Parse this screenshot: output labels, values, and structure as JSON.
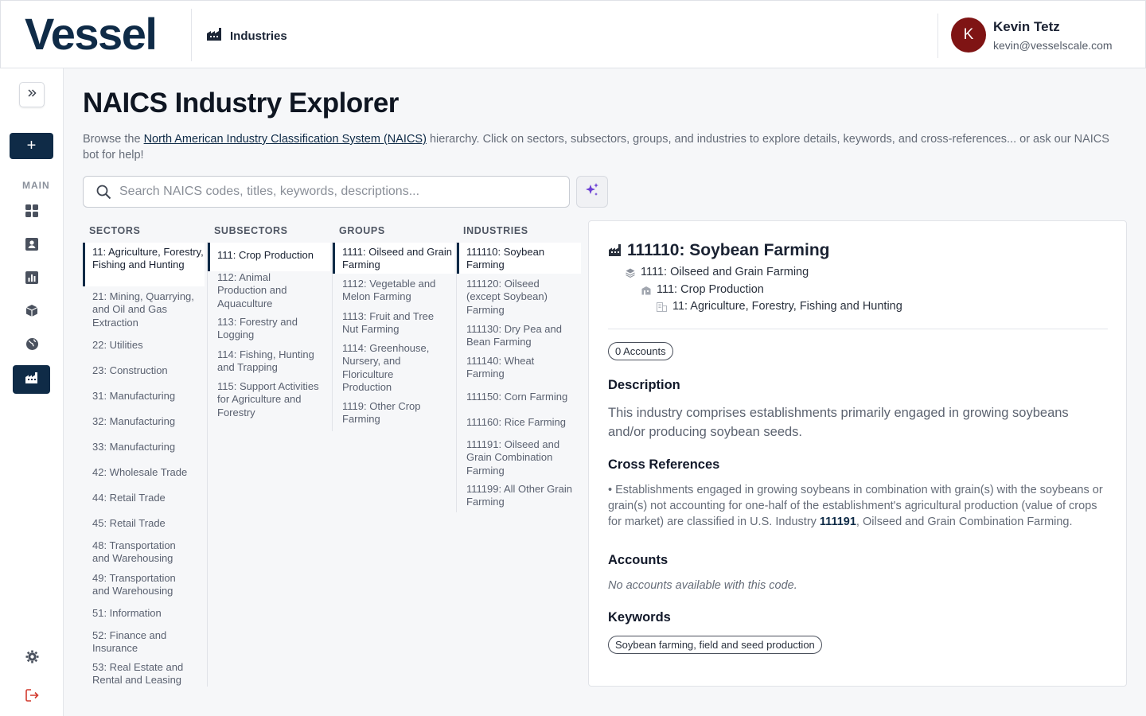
{
  "app": {
    "logo": "Vessel"
  },
  "header": {
    "breadcrumb": "Industries",
    "user": {
      "initial": "K",
      "name": "Kevin Tetz",
      "email": "kevin@vesselscale.com"
    }
  },
  "sidebar": {
    "add_label": "+",
    "section_label": "MAIN"
  },
  "page": {
    "title": "NAICS Industry Explorer",
    "intro_before": "Browse the ",
    "intro_link": "North American Industry Classification System (NAICS)",
    "intro_after": " hierarchy. Click on sectors, subsectors, groups, and industries to explore details, keywords, and cross-references... or ask our NAICS bot for help!",
    "search_placeholder": "Search NAICS codes, titles, keywords, descriptions..."
  },
  "columns": {
    "sectors": {
      "label": "SECTORS",
      "items": [
        "11: Agriculture, Forestry, Fishing and Hunting",
        "21: Mining, Quarrying, and Oil and Gas Extraction",
        "22: Utilities",
        "23: Construction",
        "31: Manufacturing",
        "32: Manufacturing",
        "33: Manufacturing",
        "42: Wholesale Trade",
        "44: Retail Trade",
        "45: Retail Trade",
        "48: Transportation and Warehousing",
        "49: Transportation and Warehousing",
        "51: Information",
        "52: Finance and Insurance",
        "53: Real Estate and Rental and Leasing"
      ]
    },
    "subsectors": {
      "label": "SUBSECTORS",
      "items": [
        "111: Crop Production",
        "112: Animal Production and Aquaculture",
        "113: Forestry and Logging",
        "114: Fishing, Hunting and Trapping",
        "115: Support Activities for Agriculture and Forestry"
      ]
    },
    "groups": {
      "label": "GROUPS",
      "items": [
        "1111: Oilseed and Grain Farming",
        "1112: Vegetable and Melon Farming",
        "1113: Fruit and Tree Nut Farming",
        "1114: Greenhouse, Nursery, and Floriculture Production",
        "1119: Other Crop Farming"
      ]
    },
    "industries": {
      "label": "INDUSTRIES",
      "items": [
        "111110: Soybean Farming",
        "111120: Oilseed (except Soybean) Farming",
        "111130: Dry Pea and Bean Farming",
        "111140: Wheat Farming",
        "111150: Corn Farming",
        "111160: Rice Farming",
        "111191: Oilseed and Grain Combination Farming",
        "111199: All Other Grain Farming"
      ]
    }
  },
  "detail": {
    "title": "111110: Soybean Farming",
    "hierarchy": [
      "1111: Oilseed and Grain Farming",
      "111: Crop Production",
      "11: Agriculture, Forestry, Fishing and Hunting"
    ],
    "accounts_badge": "0 Accounts",
    "description_heading": "Description",
    "description": "This industry comprises establishments primarily engaged in growing soybeans and/or producing soybean seeds.",
    "xref_heading": "Cross References",
    "xref_before": "• Establishments engaged in growing soybeans in combination with grain(s) with the soybeans or grain(s) not accounting for one-half of the establishment's agricultural production (value of crops for market) are classified in U.S. Industry ",
    "xref_code": "111191",
    "xref_after": ", Oilseed and Grain Combination Farming.",
    "accounts_heading": "Accounts",
    "accounts_empty": "No accounts available with this code.",
    "keywords_heading": "Keywords",
    "keyword": "Soybean farming, field and seed production"
  },
  "colors": {
    "brand": "#0f2b47",
    "avatar": "#7f1414",
    "ai_accent": "#6b3fd4",
    "logout": "#d23a2e"
  }
}
